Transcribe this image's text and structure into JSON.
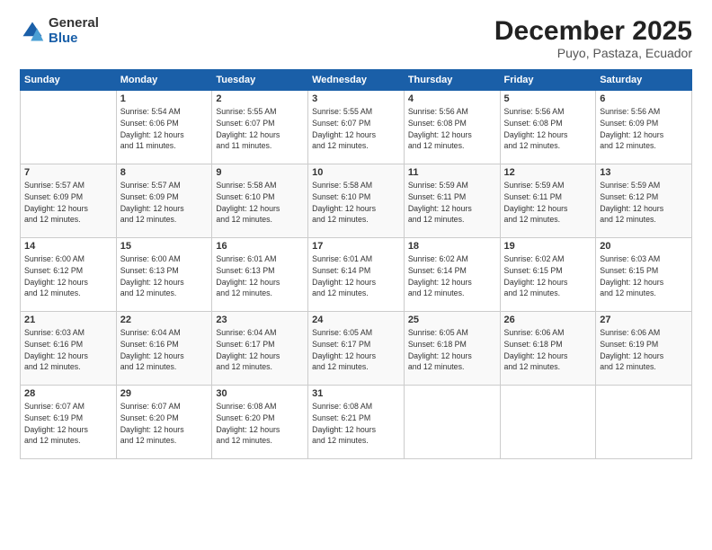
{
  "logo": {
    "general": "General",
    "blue": "Blue"
  },
  "title": {
    "month": "December 2025",
    "location": "Puyo, Pastaza, Ecuador"
  },
  "weekdays": [
    "Sunday",
    "Monday",
    "Tuesday",
    "Wednesday",
    "Thursday",
    "Friday",
    "Saturday"
  ],
  "weeks": [
    [
      {
        "day": "",
        "info": ""
      },
      {
        "day": "1",
        "info": "Sunrise: 5:54 AM\nSunset: 6:06 PM\nDaylight: 12 hours\nand 11 minutes."
      },
      {
        "day": "2",
        "info": "Sunrise: 5:55 AM\nSunset: 6:07 PM\nDaylight: 12 hours\nand 11 minutes."
      },
      {
        "day": "3",
        "info": "Sunrise: 5:55 AM\nSunset: 6:07 PM\nDaylight: 12 hours\nand 12 minutes."
      },
      {
        "day": "4",
        "info": "Sunrise: 5:56 AM\nSunset: 6:08 PM\nDaylight: 12 hours\nand 12 minutes."
      },
      {
        "day": "5",
        "info": "Sunrise: 5:56 AM\nSunset: 6:08 PM\nDaylight: 12 hours\nand 12 minutes."
      },
      {
        "day": "6",
        "info": "Sunrise: 5:56 AM\nSunset: 6:09 PM\nDaylight: 12 hours\nand 12 minutes."
      }
    ],
    [
      {
        "day": "7",
        "info": "Sunrise: 5:57 AM\nSunset: 6:09 PM\nDaylight: 12 hours\nand 12 minutes."
      },
      {
        "day": "8",
        "info": "Sunrise: 5:57 AM\nSunset: 6:09 PM\nDaylight: 12 hours\nand 12 minutes."
      },
      {
        "day": "9",
        "info": "Sunrise: 5:58 AM\nSunset: 6:10 PM\nDaylight: 12 hours\nand 12 minutes."
      },
      {
        "day": "10",
        "info": "Sunrise: 5:58 AM\nSunset: 6:10 PM\nDaylight: 12 hours\nand 12 minutes."
      },
      {
        "day": "11",
        "info": "Sunrise: 5:59 AM\nSunset: 6:11 PM\nDaylight: 12 hours\nand 12 minutes."
      },
      {
        "day": "12",
        "info": "Sunrise: 5:59 AM\nSunset: 6:11 PM\nDaylight: 12 hours\nand 12 minutes."
      },
      {
        "day": "13",
        "info": "Sunrise: 5:59 AM\nSunset: 6:12 PM\nDaylight: 12 hours\nand 12 minutes."
      }
    ],
    [
      {
        "day": "14",
        "info": "Sunrise: 6:00 AM\nSunset: 6:12 PM\nDaylight: 12 hours\nand 12 minutes."
      },
      {
        "day": "15",
        "info": "Sunrise: 6:00 AM\nSunset: 6:13 PM\nDaylight: 12 hours\nand 12 minutes."
      },
      {
        "day": "16",
        "info": "Sunrise: 6:01 AM\nSunset: 6:13 PM\nDaylight: 12 hours\nand 12 minutes."
      },
      {
        "day": "17",
        "info": "Sunrise: 6:01 AM\nSunset: 6:14 PM\nDaylight: 12 hours\nand 12 minutes."
      },
      {
        "day": "18",
        "info": "Sunrise: 6:02 AM\nSunset: 6:14 PM\nDaylight: 12 hours\nand 12 minutes."
      },
      {
        "day": "19",
        "info": "Sunrise: 6:02 AM\nSunset: 6:15 PM\nDaylight: 12 hours\nand 12 minutes."
      },
      {
        "day": "20",
        "info": "Sunrise: 6:03 AM\nSunset: 6:15 PM\nDaylight: 12 hours\nand 12 minutes."
      }
    ],
    [
      {
        "day": "21",
        "info": "Sunrise: 6:03 AM\nSunset: 6:16 PM\nDaylight: 12 hours\nand 12 minutes."
      },
      {
        "day": "22",
        "info": "Sunrise: 6:04 AM\nSunset: 6:16 PM\nDaylight: 12 hours\nand 12 minutes."
      },
      {
        "day": "23",
        "info": "Sunrise: 6:04 AM\nSunset: 6:17 PM\nDaylight: 12 hours\nand 12 minutes."
      },
      {
        "day": "24",
        "info": "Sunrise: 6:05 AM\nSunset: 6:17 PM\nDaylight: 12 hours\nand 12 minutes."
      },
      {
        "day": "25",
        "info": "Sunrise: 6:05 AM\nSunset: 6:18 PM\nDaylight: 12 hours\nand 12 minutes."
      },
      {
        "day": "26",
        "info": "Sunrise: 6:06 AM\nSunset: 6:18 PM\nDaylight: 12 hours\nand 12 minutes."
      },
      {
        "day": "27",
        "info": "Sunrise: 6:06 AM\nSunset: 6:19 PM\nDaylight: 12 hours\nand 12 minutes."
      }
    ],
    [
      {
        "day": "28",
        "info": "Sunrise: 6:07 AM\nSunset: 6:19 PM\nDaylight: 12 hours\nand 12 minutes."
      },
      {
        "day": "29",
        "info": "Sunrise: 6:07 AM\nSunset: 6:20 PM\nDaylight: 12 hours\nand 12 minutes."
      },
      {
        "day": "30",
        "info": "Sunrise: 6:08 AM\nSunset: 6:20 PM\nDaylight: 12 hours\nand 12 minutes."
      },
      {
        "day": "31",
        "info": "Sunrise: 6:08 AM\nSunset: 6:21 PM\nDaylight: 12 hours\nand 12 minutes."
      },
      {
        "day": "",
        "info": ""
      },
      {
        "day": "",
        "info": ""
      },
      {
        "day": "",
        "info": ""
      }
    ]
  ]
}
